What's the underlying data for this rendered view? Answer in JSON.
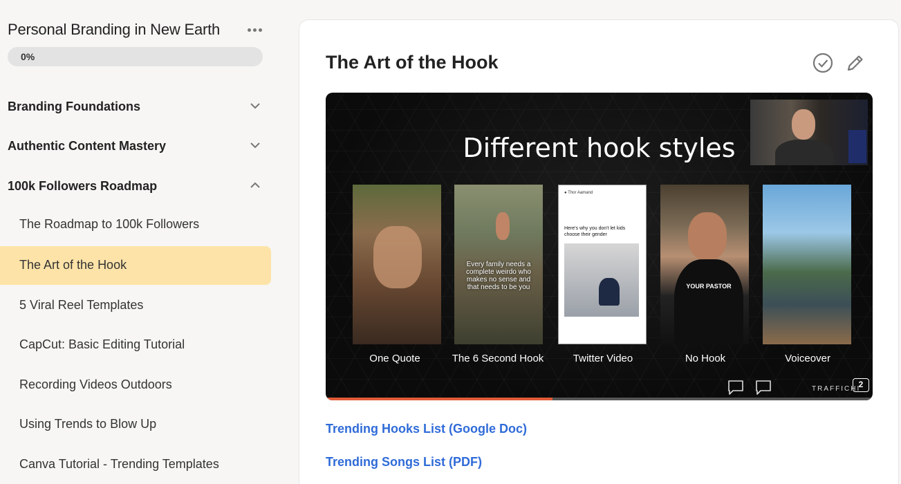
{
  "course": {
    "title": "Personal Branding in New Earth",
    "progress_label": "0%",
    "progress_fraction": 0
  },
  "sections": [
    {
      "label": "Branding Foundations",
      "expanded": false,
      "icon": "chevron-down-icon"
    },
    {
      "label": "Authentic Content Mastery",
      "expanded": false,
      "icon": "chevron-down-icon"
    },
    {
      "label": "100k Followers Roadmap",
      "expanded": true,
      "icon": "chevron-up-icon"
    }
  ],
  "lessons": [
    {
      "label": "The Roadmap to 100k Followers",
      "active": false
    },
    {
      "label": "The Art of the Hook",
      "active": true
    },
    {
      "label": "5 Viral Reel Templates",
      "active": false
    },
    {
      "label": "CapCut: Basic Editing Tutorial",
      "active": false
    },
    {
      "label": "Recording Videos Outdoors",
      "active": false
    },
    {
      "label": "Using Trends to Blow Up",
      "active": false
    },
    {
      "label": "Canva Tutorial - Trending Templates",
      "active": false
    }
  ],
  "main": {
    "title": "The Art of the Hook",
    "icons": [
      "check-circle-icon",
      "pencil-icon"
    ]
  },
  "video": {
    "slide_title": "Different hook styles",
    "progress_fraction": 0.415,
    "thumbnails": [
      {
        "label": "One Quote",
        "caption": ""
      },
      {
        "label": "The 6 Second Hook",
        "caption": "Every family needs a complete weirdo who makes no sense and that needs to be you"
      },
      {
        "label": "Twitter Video",
        "caption": "Here's why you don't let kids choose their gender"
      },
      {
        "label": "No Hook",
        "caption": "YOUR PASTOR"
      },
      {
        "label": "Voiceover",
        "caption": ""
      }
    ],
    "brand": "TRAFFICHI",
    "brand_badge": "2"
  },
  "resources": [
    {
      "label": "Trending Hooks List (Google Doc)"
    },
    {
      "label": "Trending Songs List (PDF)"
    }
  ],
  "colors": {
    "accent": "#fde3a8",
    "link": "#2f6bd8",
    "seek": "#e25b37"
  }
}
